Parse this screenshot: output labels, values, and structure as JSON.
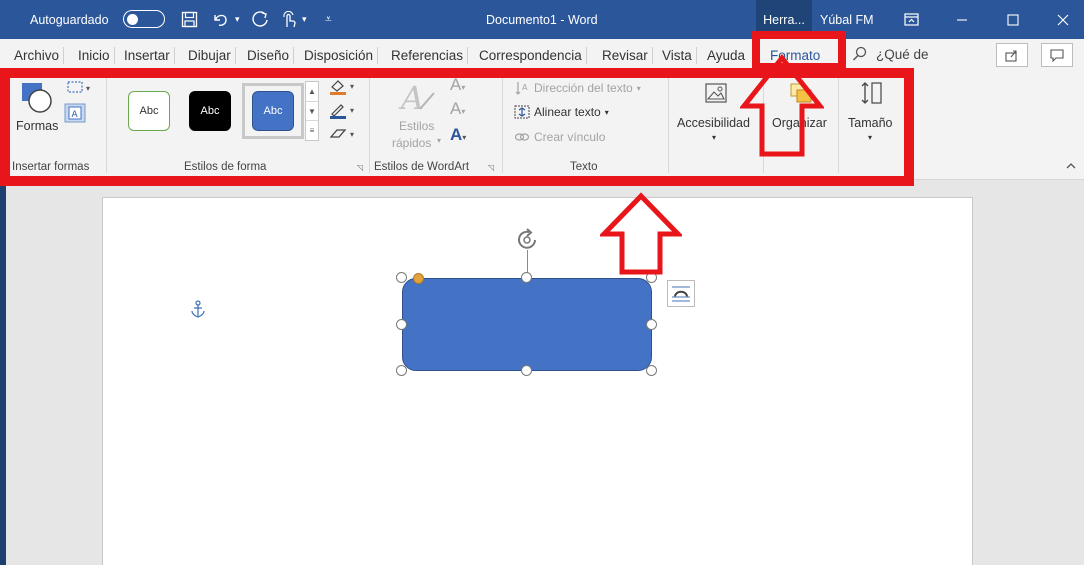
{
  "titlebar": {
    "autosave_label": "Autoguardado",
    "document_title": "Documento1  -  Word",
    "context_tab": "Herra...",
    "user_name": "Yúbal FM",
    "icons": [
      "save-icon",
      "undo-icon",
      "redo-icon",
      "touch-icon",
      "customize-icon",
      "ribbon-display-icon",
      "minimize-icon",
      "maximize-icon",
      "close-icon"
    ],
    "color": "#2b579a"
  },
  "tabs": [
    {
      "label": "Archivo"
    },
    {
      "label": "Inicio"
    },
    {
      "label": "Insertar"
    },
    {
      "label": "Dibujar"
    },
    {
      "label": "Diseño"
    },
    {
      "label": "Disposición"
    },
    {
      "label": "Referencias"
    },
    {
      "label": "Correspondencia"
    },
    {
      "label": "Revisar"
    },
    {
      "label": "Vista"
    },
    {
      "label": "Ayuda"
    },
    {
      "label": "Formato",
      "active": true
    }
  ],
  "search": {
    "label": "¿Qué de"
  },
  "ribbon": {
    "insert_shapes": {
      "shapes_label": "Formas",
      "group_label": "Insertar formas"
    },
    "shape_styles": {
      "style_text": "Abc",
      "group_label": "Estilos de forma",
      "styles": [
        "#ffffff",
        "#000000",
        "#4472c4"
      ]
    },
    "wordart": {
      "quick_styles_line1": "Estilos",
      "quick_styles_line2": "rápidos",
      "group_label": "Estilos de WordArt"
    },
    "text": {
      "direction": "Dirección del texto",
      "align": "Alinear texto",
      "link": "Crear vínculo",
      "group_label": "Texto"
    },
    "accessibility": {
      "label": "Accesibilidad"
    },
    "arrange": {
      "label": "Organizar"
    },
    "size": {
      "label": "Tamaño"
    }
  },
  "annotation_color": "#e8161a"
}
